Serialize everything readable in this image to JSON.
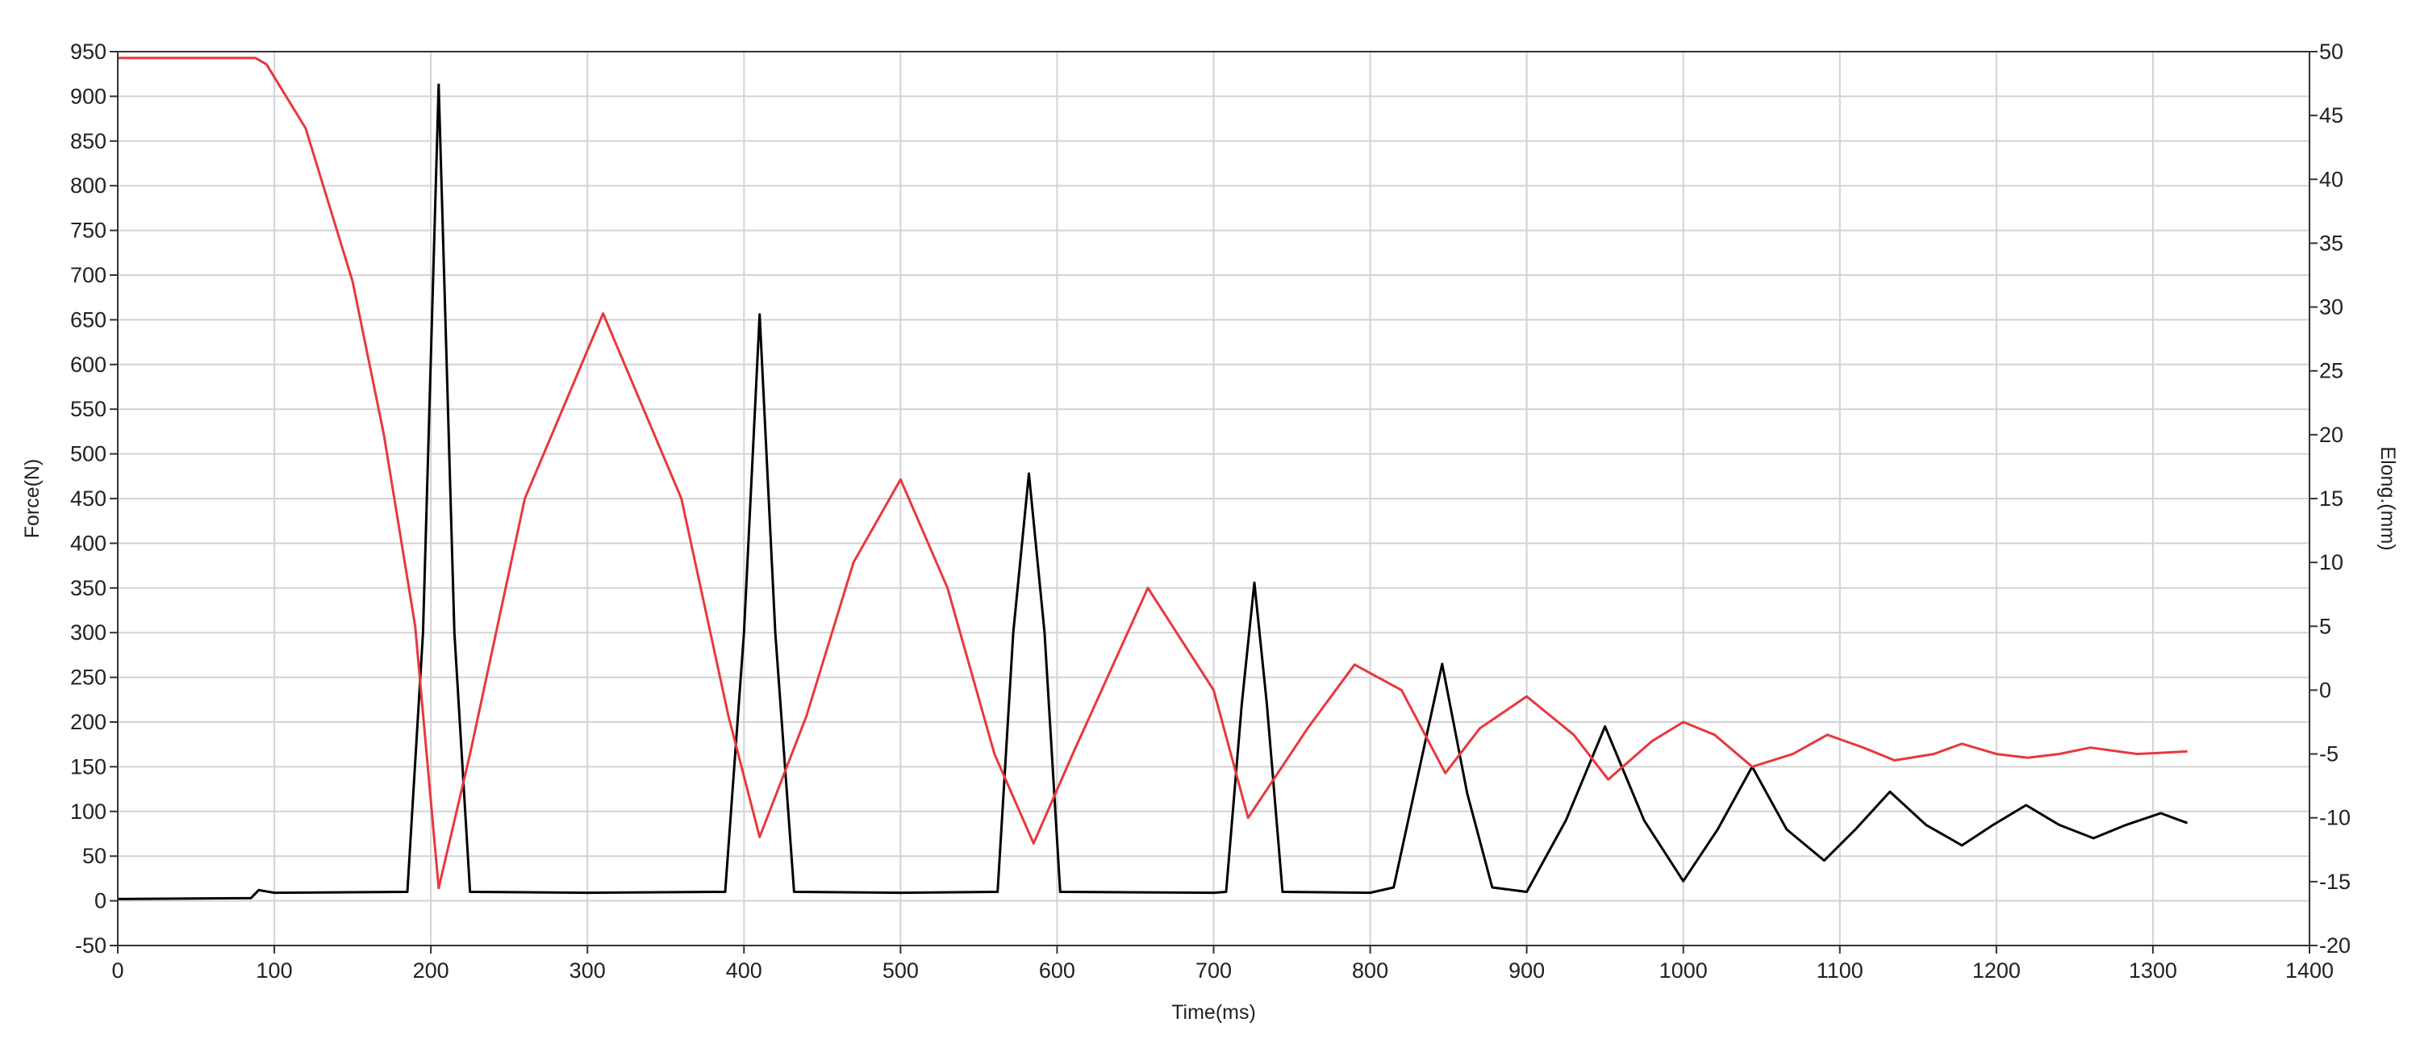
{
  "chart_data": {
    "type": "line",
    "title": "",
    "xlabel": "Time(ms)",
    "ylabel": "Force(N)",
    "y2label": "Elong.(mm)",
    "xlim": [
      0,
      1400
    ],
    "ylim": [
      -50,
      950
    ],
    "y2lim": [
      -20,
      50
    ],
    "grid": true,
    "x_ticks": [
      "0",
      "100",
      "200",
      "300",
      "400",
      "500",
      "600",
      "700",
      "800",
      "900",
      "1000",
      "1100",
      "1200",
      "1300",
      "1400"
    ],
    "y_ticks": [
      "-50",
      "0",
      "50",
      "100",
      "150",
      "200",
      "250",
      "300",
      "350",
      "400",
      "450",
      "500",
      "550",
      "600",
      "650",
      "700",
      "750",
      "800",
      "850",
      "900",
      "950"
    ],
    "y2_ticks": [
      "-20",
      "-15",
      "-10",
      "-5",
      "0",
      "5",
      "10",
      "15",
      "20",
      "25",
      "30",
      "35",
      "40",
      "45",
      "50"
    ],
    "series": [
      {
        "axis": "left",
        "color": "#000000",
        "x": [
          0,
          85,
          90,
          100,
          185,
          195,
          205,
          215,
          225,
          300,
          388,
          400,
          410,
          420,
          432,
          500,
          562,
          572,
          582,
          592,
          602,
          700,
          708,
          718,
          726,
          734,
          744,
          800,
          815,
          828,
          846,
          862,
          878,
          900,
          925,
          950,
          975,
          1000,
          1022,
          1044,
          1066,
          1090,
          1110,
          1132,
          1155,
          1178,
          1198,
          1219,
          1240,
          1262,
          1283,
          1305,
          1322
        ],
        "y": [
          2,
          3,
          12,
          9,
          10,
          300,
          913,
          300,
          10,
          9,
          10,
          300,
          656,
          300,
          10,
          9,
          10,
          300,
          478,
          300,
          10,
          9,
          10,
          220,
          356,
          220,
          10,
          9,
          15,
          120,
          265,
          120,
          15,
          10,
          90,
          195,
          90,
          22,
          80,
          150,
          80,
          45,
          80,
          122,
          85,
          62,
          85,
          107,
          85,
          70,
          85,
          98,
          87
        ]
      },
      {
        "axis": "right",
        "color": "#e8383d",
        "x": [
          0,
          88,
          95,
          120,
          150,
          170,
          190,
          205,
          225,
          260,
          310,
          360,
          390,
          410,
          440,
          470,
          500,
          530,
          560,
          585,
          610,
          658,
          700,
          722,
          760,
          790,
          820,
          848,
          870,
          900,
          930,
          952,
          980,
          1000,
          1020,
          1044,
          1070,
          1092,
          1115,
          1135,
          1160,
          1178,
          1200,
          1220,
          1240,
          1260,
          1290,
          1322
        ],
        "y": [
          49.5,
          49.5,
          49,
          44,
          32,
          20,
          5,
          -15.5,
          -5,
          15,
          29.5,
          15,
          -2,
          -11.5,
          -2,
          10,
          16.5,
          8,
          -5,
          -12,
          -5,
          8,
          0,
          -10,
          -3,
          2,
          0,
          -6.5,
          -3,
          -0.5,
          -3.5,
          -7,
          -4,
          -2.5,
          -3.5,
          -6,
          -5,
          -3.5,
          -4.5,
          -5.5,
          -5,
          -4.2,
          -5,
          -5.3,
          -5,
          -4.5,
          -5,
          -4.8
        ]
      }
    ]
  }
}
